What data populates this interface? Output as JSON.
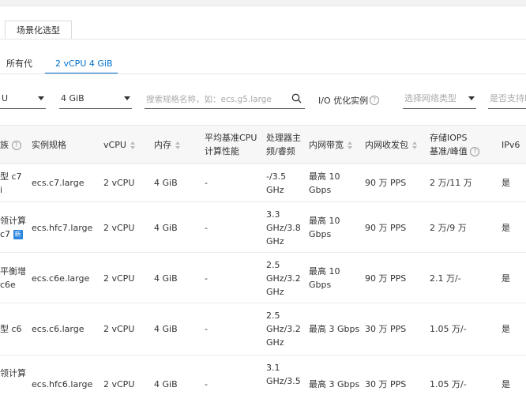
{
  "tabs": {
    "scene": "场景化选型"
  },
  "subtabs": [
    {
      "label": "所有代"
    },
    {
      "label": "2 vCPU 4 GiB"
    }
  ],
  "filters": {
    "vcpu_value": "U",
    "memory_value": "4 GiB",
    "search_placeholder": "搜索规格名称，如：ecs.g5.large",
    "io_label": "I/O 优化实例",
    "network_placeholder": "选择网络类型",
    "ipv6_placeholder": "是否支持I"
  },
  "table": {
    "headers": {
      "family": "族",
      "spec": "实例规格",
      "vcpu": "vCPU",
      "memory": "内存",
      "baseline_1": "平均基准CPU",
      "baseline_2": "计算性能",
      "cpu_freq_1": "处理器主",
      "cpu_freq_2": "频/睿频",
      "bandwidth": "内网带宽",
      "pps": "内网收发包",
      "iops_1": "存储IOPS",
      "iops_2": "基准/峰值",
      "ipv6": "IPv6"
    },
    "rows": [
      {
        "family": [
          "型 c7",
          "i"
        ],
        "spec": "ecs.c7.large",
        "vcpu": "2 vCPU",
        "memory": "4 GiB",
        "baseline": "-",
        "freq": [
          "-/3.5",
          "GHz"
        ],
        "bw": [
          "最高 10",
          "Gbps"
        ],
        "pps": "90 万 PPS",
        "iops": "2 万/11 万",
        "ipv6": "是"
      },
      {
        "family": [
          "领计算",
          "c7"
        ],
        "spec": "ecs.hfc7.large",
        "vcpu": "2 vCPU",
        "memory": "4 GiB",
        "baseline": "-",
        "freq": [
          "3.3",
          "GHz/3.8",
          "GHz"
        ],
        "bw": [
          "最高 10",
          "Gbps"
        ],
        "pps": "90 万 PPS",
        "iops": "2 万/9 万",
        "ipv6": "是"
      },
      {
        "family": [
          "平衡增",
          "c6e"
        ],
        "spec": "ecs.c6e.large",
        "vcpu": "2 vCPU",
        "memory": "4 GiB",
        "baseline": "-",
        "freq": [
          "2.5",
          "GHz/3.2",
          "GHz"
        ],
        "bw": [
          "最高 10",
          "Gbps"
        ],
        "pps": "90 万 PPS",
        "iops": "2.1 万/-",
        "ipv6": "是"
      },
      {
        "family": [
          "型 c6"
        ],
        "spec": "ecs.c6.large",
        "vcpu": "2 vCPU",
        "memory": "4 GiB",
        "baseline": "-",
        "freq": [
          "2.5",
          "GHz/3.2",
          "GHz"
        ],
        "bw": [
          "最高 3 Gbps"
        ],
        "pps": "30 万 PPS",
        "iops": "1.05 万/-",
        "ipv6": "是"
      },
      {
        "family": [
          "领计算"
        ],
        "spec": "ecs.hfc6.large",
        "vcpu": "2 vCPU",
        "memory": "4 GiB",
        "baseline": "-",
        "freq": [
          "3.1",
          "GHz/3.5"
        ],
        "bw": [
          "最高 3 Gbps"
        ],
        "pps": "30 万 PPS",
        "iops": "1.05 万/-",
        "ipv6": "是"
      }
    ]
  },
  "colors": {
    "accent": "#0070cc",
    "badge": "#2b86e0"
  }
}
